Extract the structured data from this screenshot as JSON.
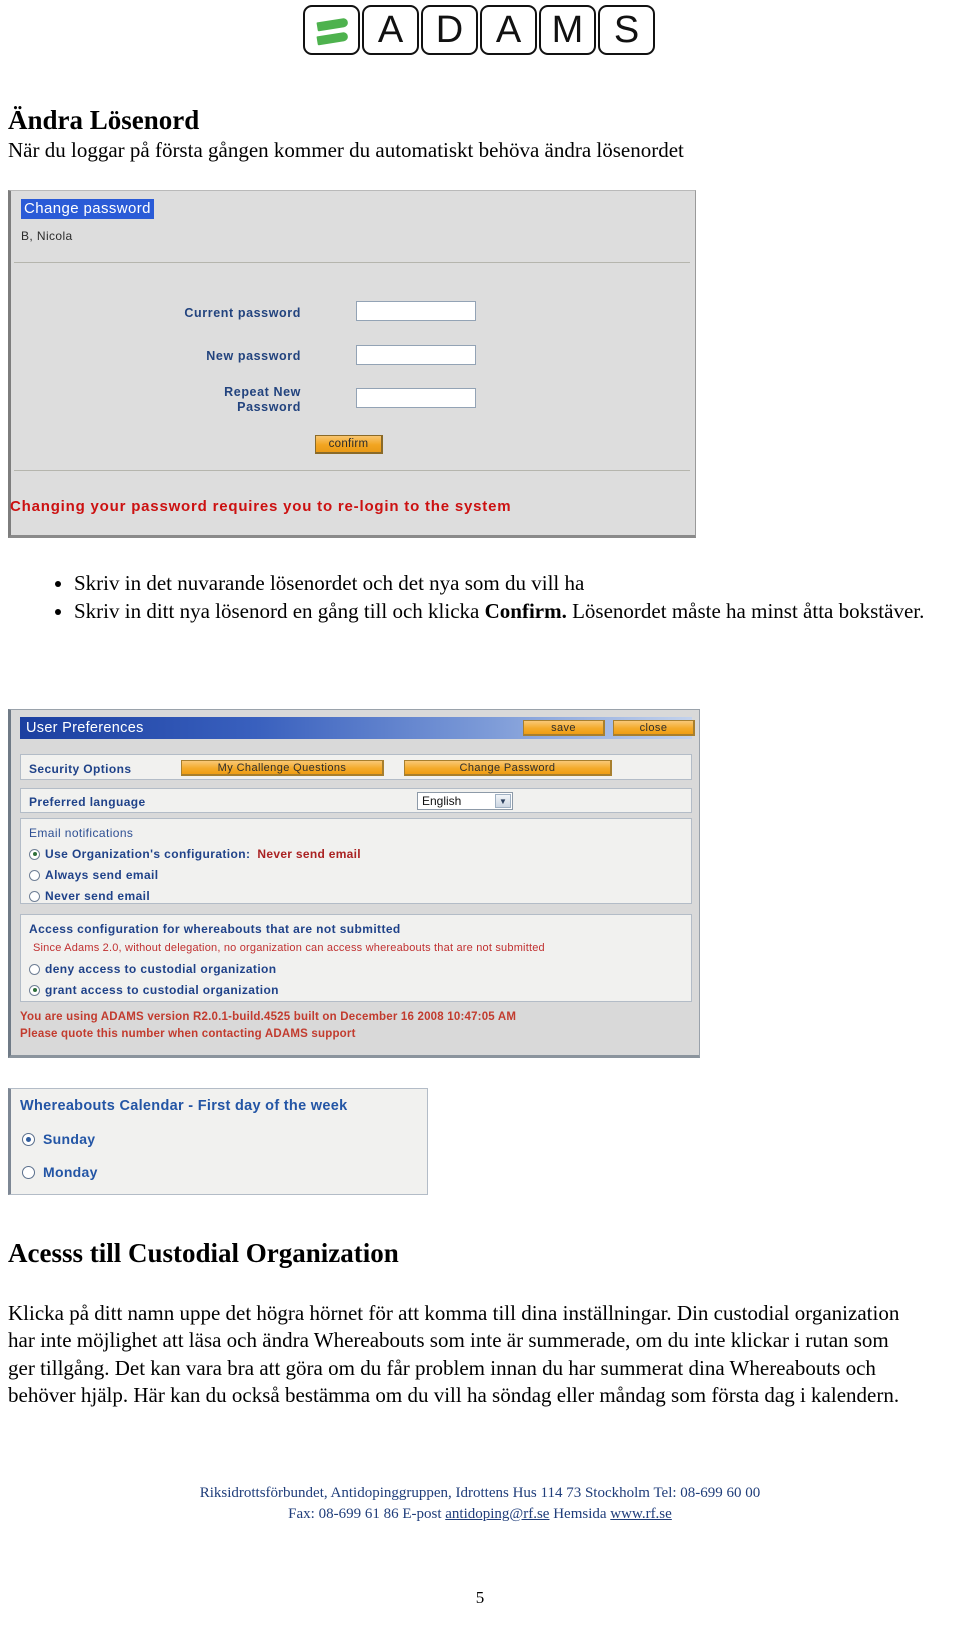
{
  "logo": {
    "name": "ADAMS",
    "tiles": [
      "leaf",
      "A",
      "D",
      "A",
      "M",
      "S"
    ],
    "leaf_color": "#4eb24e"
  },
  "doc": {
    "heading1": "Ändra Lösenord",
    "intro": "När du loggar på första gången kommer du automatiskt behöva ändra lösenordet",
    "bullets": [
      "Skriv in det nuvarande lösenordet och det nya som du vill ha",
      "Skriv in ditt nya lösenord en gång till och klicka Confirm. Lösenordet måste ha minst åtta bokstäver."
    ],
    "bullet2_prefix": "Skriv in ditt nya lösenord en gång till och klicka ",
    "bullet2_bold": "Confirm.",
    "bullet2_suffix": " Lösenordet måste ha minst åtta bokstäver.",
    "heading2": "Acesss till Custodial Organization",
    "paragraph": "Klicka på ditt namn uppe det högra hörnet för att komma till dina inställningar. Din custodial organization har inte möjlighet att läsa och ändra Whereabouts som inte är summerade, om du inte klickar i rutan som ger tillgång. Det kan vara bra att göra om du får problem innan du har summerat dina Whereabouts och behöver hjälp. Här kan du också bestämma om du vill ha söndag eller måndag som första dag i kalendern."
  },
  "change_password": {
    "title": "Change password",
    "user": "B, Nicola",
    "fields": [
      {
        "label": "Current password",
        "value": ""
      },
      {
        "label": "New password",
        "value": ""
      },
      {
        "label": "Repeat New\nPassword",
        "label_line1": "Repeat New",
        "label_line2": "Password",
        "value": ""
      }
    ],
    "confirm_button": "confirm",
    "warning": "Changing your password requires you to re-login to the system"
  },
  "user_preferences": {
    "title": "User Preferences",
    "save_label": "save",
    "close_label": "close",
    "security_options_label": "Security Options",
    "challenge_questions_button": "My Challenge Questions",
    "change_password_button": "Change Password",
    "preferred_language_label": "Preferred language",
    "preferred_language_value": "English",
    "email_notifications": {
      "heading": "Email notifications",
      "options": [
        {
          "label": "Use Organization's configuration:",
          "suffix": "Never send email",
          "selected": true
        },
        {
          "label": "Always send email",
          "suffix": "",
          "selected": false
        },
        {
          "label": "Never send email",
          "suffix": "",
          "selected": false
        }
      ]
    },
    "access_configuration": {
      "heading": "Access configuration for whereabouts that are not submitted",
      "note": "Since Adams 2.0, without delegation, no organization can access whereabouts that are not submitted",
      "options": [
        {
          "label": "deny access to custodial organization",
          "selected": false
        },
        {
          "label": "grant access to custodial organization",
          "selected": true
        }
      ]
    },
    "version_line1": "You are using ADAMS version R2.0.1-build.4525 built on December 16 2008 10:47:05 AM",
    "version_line2": "Please quote this number when contacting ADAMS support"
  },
  "whereabouts_calendar": {
    "title": "Whereabouts Calendar - First day of the week",
    "options": [
      {
        "label": "Sunday",
        "selected": true
      },
      {
        "label": "Monday",
        "selected": false
      }
    ]
  },
  "footer": {
    "line1": "Riksidrottsförbundet, Antidopinggruppen, Idrottens Hus 114 73 Stockholm Tel: 08-699 60 00",
    "line2_pre": "Fax: 08-699 61 86 E-post ",
    "line2_email": "antidoping@rf.se",
    "line2_mid": " Hemsida ",
    "line2_site": "www.rf.se",
    "page_number": "5"
  },
  "colors": {
    "accent_orange": "#f4ab2c",
    "title_blue": "#1b3fa0",
    "label_blue": "#1f4289",
    "warning_red": "#cc1111",
    "footer_blue": "#1f3d7a"
  }
}
